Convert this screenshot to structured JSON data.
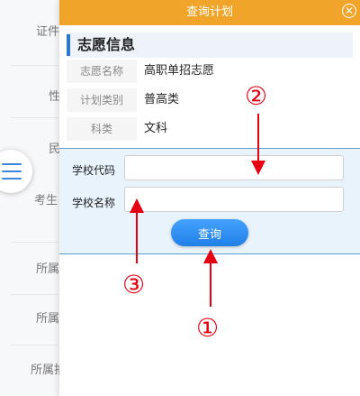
{
  "background_page": {
    "labels": [
      "证件",
      "性",
      "民",
      "考生",
      "所属",
      "所属",
      "所属拍"
    ]
  },
  "dialog": {
    "title": "查询计划",
    "close_icon": "close-icon",
    "header_color": "#f0a52a"
  },
  "section": {
    "title": "志愿信息",
    "accent_color": "#2a78d4"
  },
  "info_rows": [
    {
      "key": "志愿名称",
      "value": "高职单招志愿"
    },
    {
      "key": "计划类别",
      "value": "普高类"
    },
    {
      "key": "科类",
      "value": "文科"
    }
  ],
  "form": {
    "school_code_label": "学校代码",
    "school_code_value": "",
    "school_name_label": "学校名称",
    "school_name_value": "",
    "query_button": "查询"
  },
  "annotations": {
    "color": "#e60012",
    "markers": [
      "①",
      "②",
      "③"
    ]
  }
}
